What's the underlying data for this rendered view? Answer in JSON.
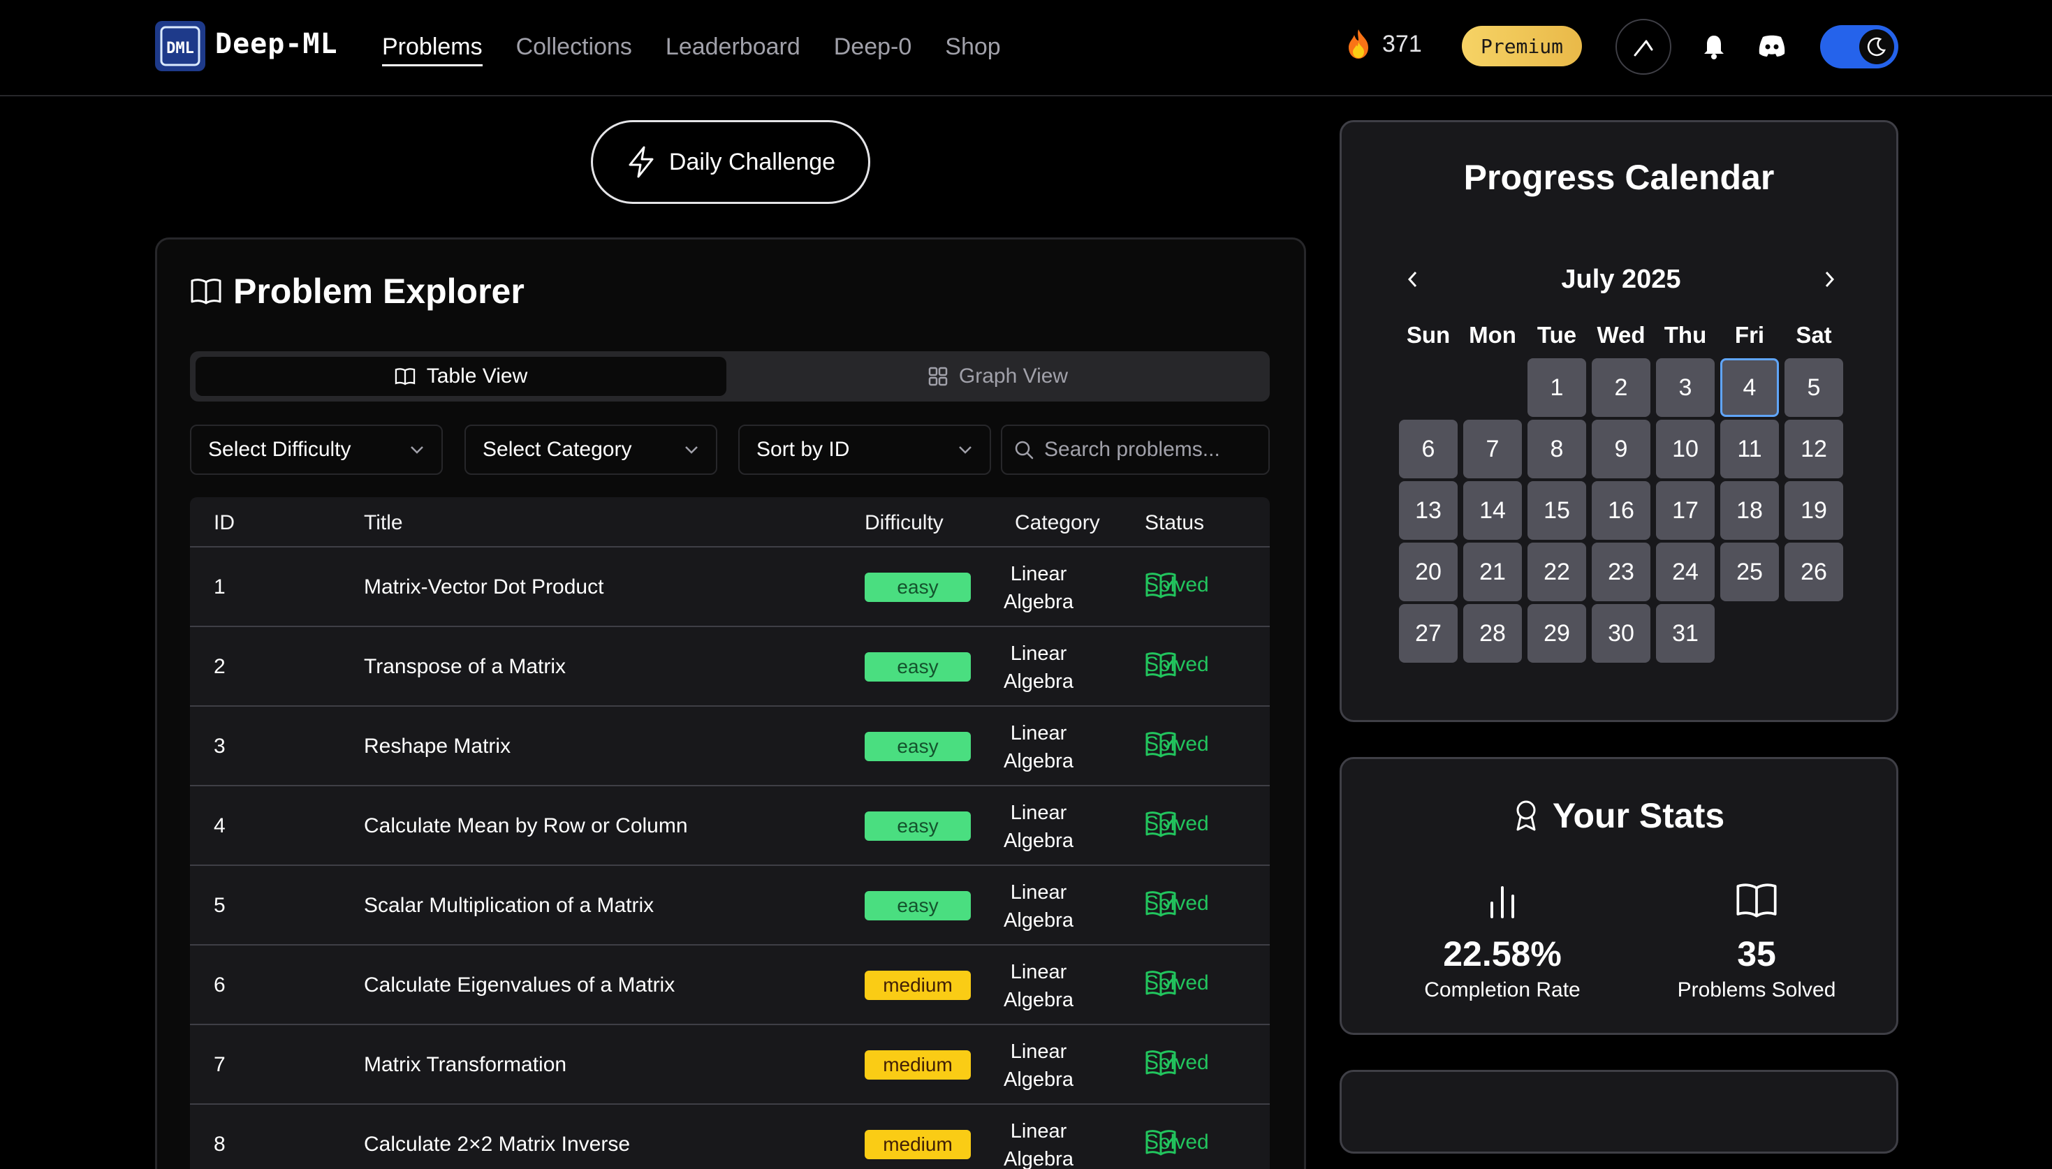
{
  "header": {
    "brand": "Deep-ML",
    "nav": [
      "Problems",
      "Collections",
      "Leaderboard",
      "Deep-0",
      "Shop"
    ],
    "streak_count": "371",
    "premium_label": "Premium",
    "toggle_state": "dark"
  },
  "daily_challenge_label": "Daily Challenge",
  "explorer": {
    "title": "Problem Explorer",
    "views": [
      "Table View",
      "Graph View"
    ],
    "active_view": "Table View",
    "filters": {
      "difficulty": "Select Difficulty",
      "category": "Select Category",
      "sort": "Sort by ID"
    },
    "search_placeholder": "Search problems...",
    "columns": [
      "ID",
      "Title",
      "Difficulty",
      "Category",
      "Status"
    ],
    "rows": [
      {
        "id": "1",
        "title": "Matrix-Vector Dot Product",
        "difficulty": "easy",
        "category": [
          "Linear",
          "Algebra"
        ],
        "status": "Solved"
      },
      {
        "id": "2",
        "title": "Transpose of a Matrix",
        "difficulty": "easy",
        "category": [
          "Linear",
          "Algebra"
        ],
        "status": "Solved"
      },
      {
        "id": "3",
        "title": "Reshape Matrix",
        "difficulty": "easy",
        "category": [
          "Linear",
          "Algebra"
        ],
        "status": "Solved"
      },
      {
        "id": "4",
        "title": "Calculate Mean by Row or Column",
        "difficulty": "easy",
        "category": [
          "Linear",
          "Algebra"
        ],
        "status": "Solved"
      },
      {
        "id": "5",
        "title": "Scalar Multiplication of a Matrix",
        "difficulty": "easy",
        "category": [
          "Linear",
          "Algebra"
        ],
        "status": "Solved"
      },
      {
        "id": "6",
        "title": "Calculate Eigenvalues of a Matrix",
        "difficulty": "medium",
        "category": [
          "Linear",
          "Algebra"
        ],
        "status": "Solved"
      },
      {
        "id": "7",
        "title": "Matrix Transformation",
        "difficulty": "medium",
        "category": [
          "Linear",
          "Algebra"
        ],
        "status": "Solved"
      },
      {
        "id": "8",
        "title": "Calculate 2×2 Matrix Inverse",
        "difficulty": "medium",
        "category": [
          "Linear",
          "Algebra"
        ],
        "status": "Solved"
      }
    ]
  },
  "calendar": {
    "title": "Progress Calendar",
    "month": "July 2025",
    "weekdays": [
      "Sun",
      "Mon",
      "Tue",
      "Wed",
      "Thu",
      "Fri",
      "Sat"
    ],
    "leading_blanks": 2,
    "days": [
      "1",
      "2",
      "3",
      "4",
      "5",
      "6",
      "7",
      "8",
      "9",
      "10",
      "11",
      "12",
      "13",
      "14",
      "15",
      "16",
      "17",
      "18",
      "19",
      "20",
      "21",
      "22",
      "23",
      "24",
      "25",
      "26",
      "27",
      "28",
      "29",
      "30",
      "31"
    ],
    "highlighted_day": "4"
  },
  "stats": {
    "title": "Your Stats",
    "completion_rate": "22.58%",
    "completion_label": "Completion Rate",
    "solved_count": "35",
    "solved_label": "Problems Solved"
  },
  "colors": {
    "accent_blue": "#2563eb",
    "easy": "#4ade80",
    "medium": "#facc15",
    "solved": "#22c55e"
  }
}
